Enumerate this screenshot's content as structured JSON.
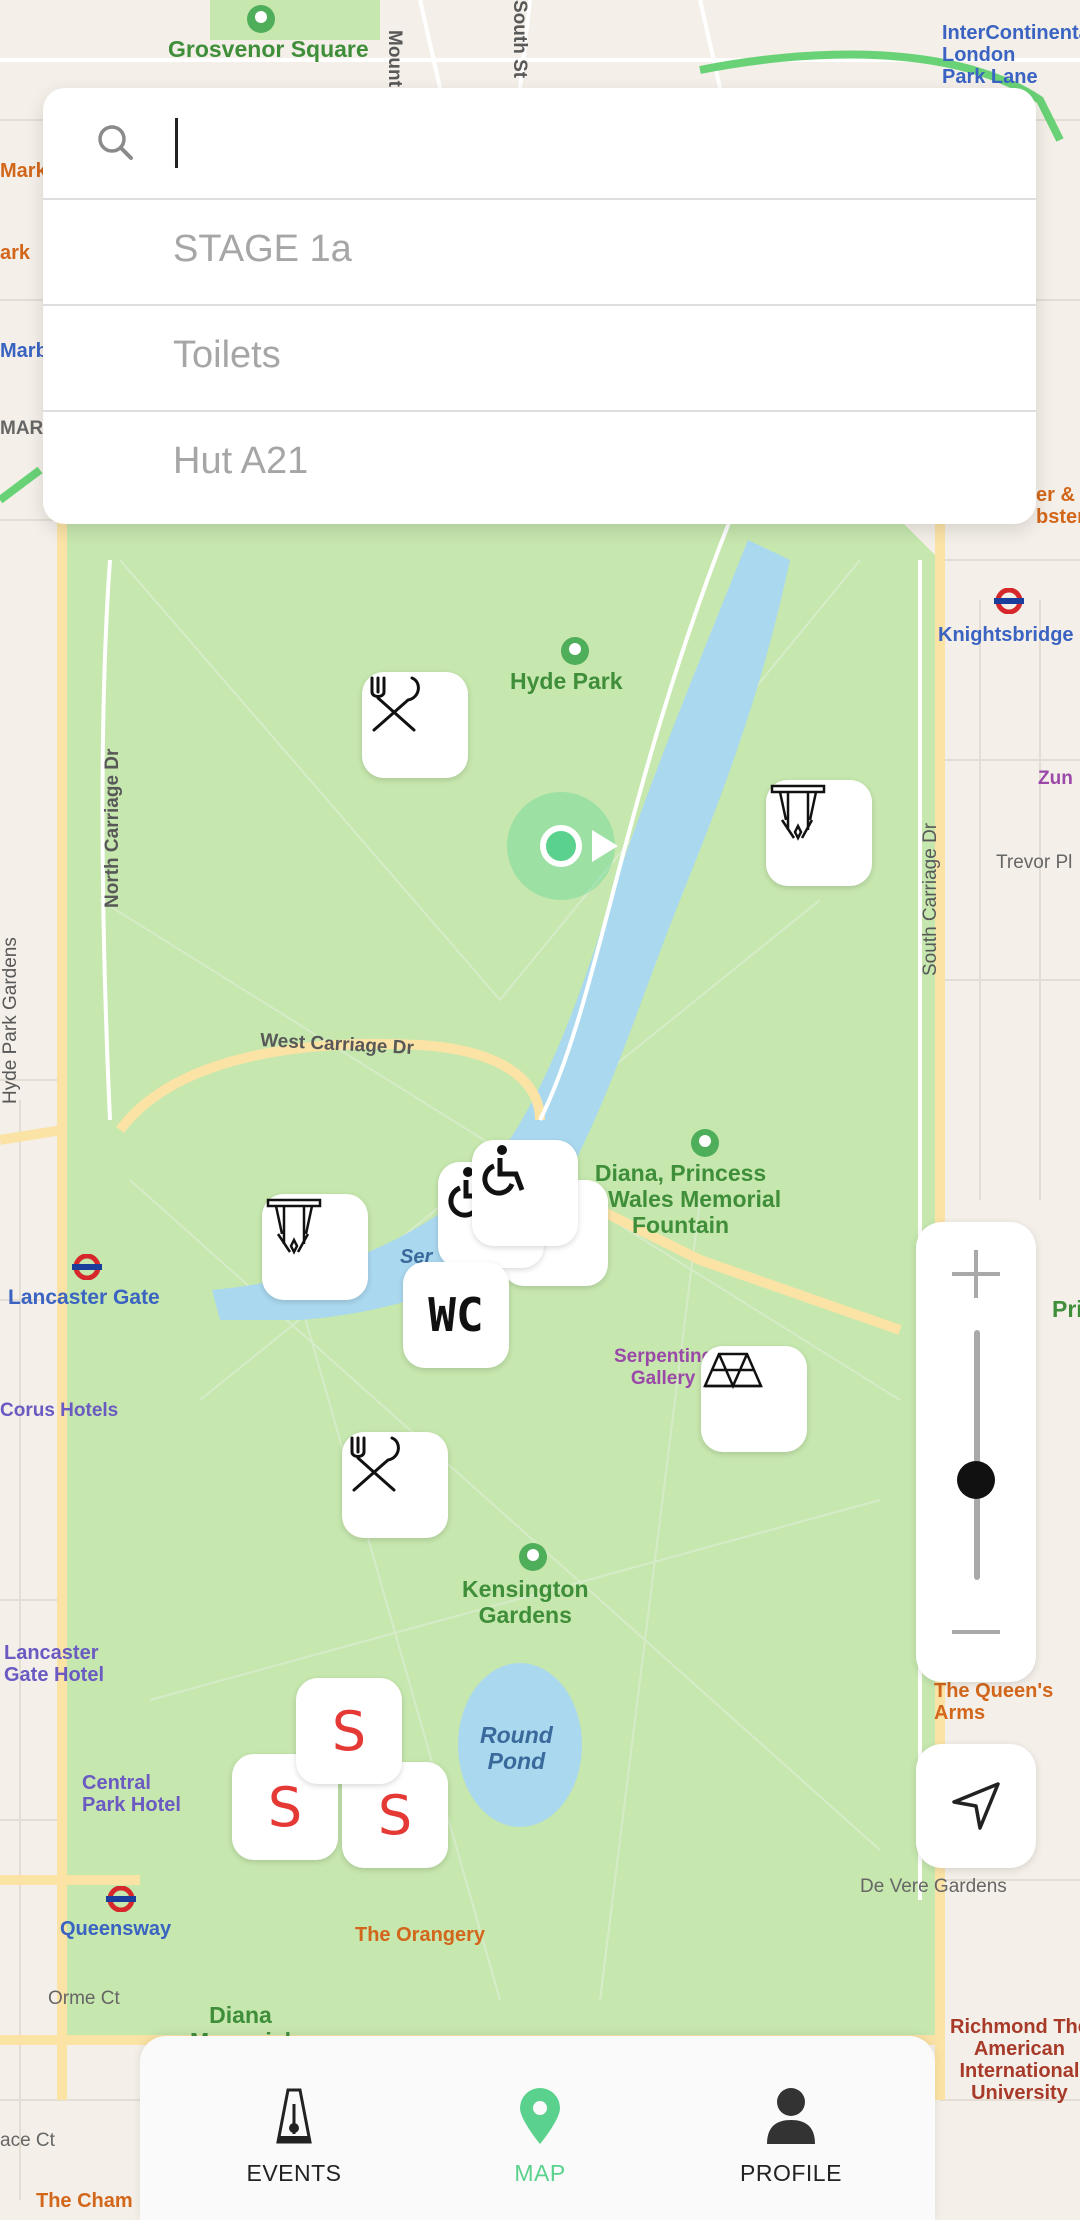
{
  "search": {
    "placeholder": "",
    "suggestions": [
      "STAGE 1a",
      "Toilets",
      "Hut A21"
    ]
  },
  "map": {
    "labels": {
      "grosvenor_square": "Grosvenor Square",
      "intercontinental": "InterContinental\nLondon\nPark Lane",
      "mount_st": "Mount",
      "south_st": "South St",
      "marble_arch": "Marble",
      "hyde_park": "Hyde Park",
      "knightsbridge": "Knightsbridge",
      "north_carriage_dr": "North Carriage Dr",
      "south_carriage_dr": "South Carriage Dr",
      "west_carriage_dr": "West Carriage Dr",
      "hyde_park_gardens": "Hyde Park Gardens",
      "trevor_pl": "Trevor Pl",
      "diana_fountain": "Diana, Princess\nof Wales Memorial\nFountain",
      "lancaster_gate": "Lancaster Gate",
      "corus_hotels": "Corus Hotels",
      "serpentine_gallery": "Serpentine\nGallery",
      "serpentine": "Ser",
      "kensington_gardens": "Kensington\nGardens",
      "lancaster_gate_hotel": "Lancaster\nGate Hotel",
      "central_park_hotel": "Central\nPark Hotel",
      "round_pond": "Round\nPond",
      "queens_arms": "The Queen's\nArms",
      "de_vere_gardens": "De Vere Gardens",
      "queensway": "Queensway",
      "the_orangery": "The Orangery",
      "orme_ct": "Orme Ct",
      "diana_memorial": "Diana\nMemorial",
      "richmond": "Richmond The\nAmerican\nInternational\nUniversity",
      "the_cham": "The Cham",
      "kensington": "Kensington",
      "bace_ct": "ace Ct",
      "zun": "Zun",
      "mark": "Mark",
      "ark": "ark",
      "mar": "MAR",
      "ter": "er &\nbster",
      "pri": "Pri",
      "pl": "Pl"
    },
    "markers": [
      {
        "kind": "food",
        "icon": "fork-knife-icon"
      },
      {
        "kind": "stage",
        "icon": "stage-lights-icon"
      },
      {
        "kind": "stage",
        "icon": "stage-lights-icon"
      },
      {
        "kind": "accessible",
        "icon": "wheelchair-icon"
      },
      {
        "kind": "toilet",
        "text": "WC"
      },
      {
        "kind": "tent",
        "icon": "tent-icon"
      },
      {
        "kind": "food",
        "icon": "fork-knife-icon"
      },
      {
        "kind": "sponsor",
        "text": "S"
      },
      {
        "kind": "sponsor",
        "text": "S"
      },
      {
        "kind": "sponsor",
        "text": "S"
      }
    ],
    "zoom_level": 0.4
  },
  "nav": {
    "items": [
      {
        "label": "EVENTS",
        "icon": "metronome-icon",
        "active": false
      },
      {
        "label": "MAP",
        "icon": "map-pin-icon",
        "active": true
      },
      {
        "label": "PROFILE",
        "icon": "person-icon",
        "active": false
      }
    ]
  },
  "colors": {
    "park": "#c6e7ae",
    "water": "#aad8ef",
    "land": "#f4efe8",
    "road": "#ffffff",
    "major_road": "#fbe3a6",
    "accent": "#5ad28e",
    "sponsor_red": "#e53935"
  }
}
